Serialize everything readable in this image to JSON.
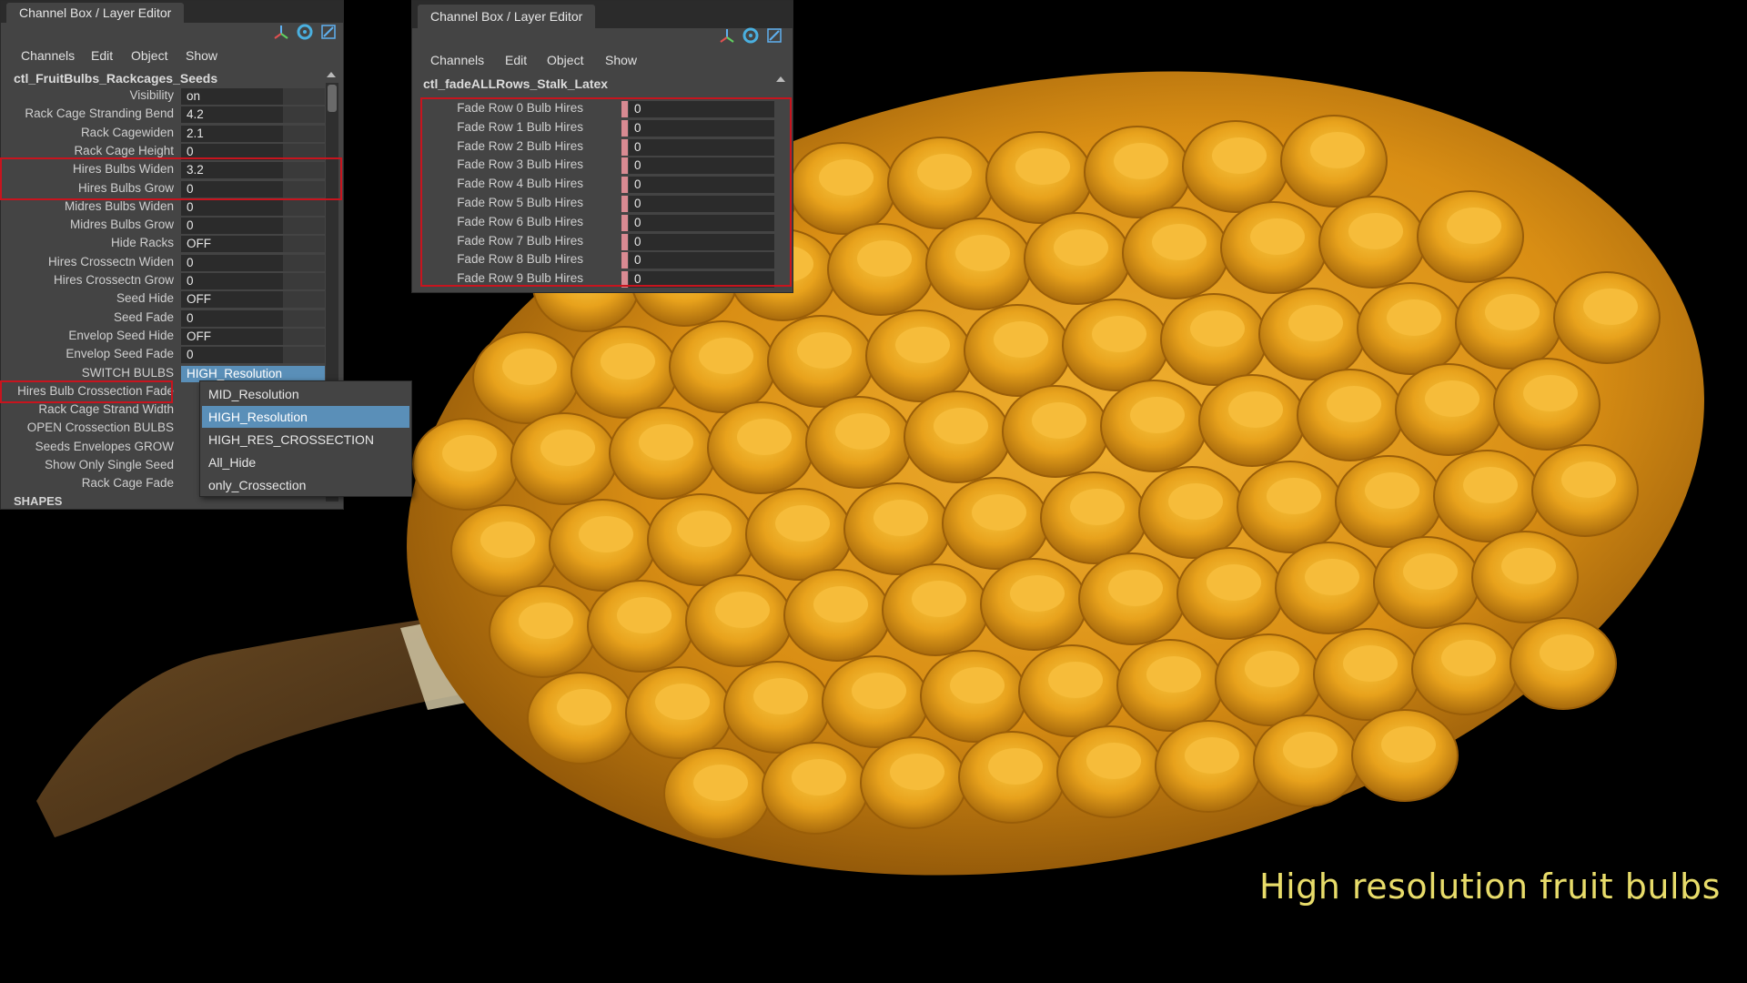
{
  "caption": "High resolution fruit bulbs",
  "colors": {
    "background": "#000000",
    "panel_bg": "#444444",
    "field_bg": "#2b2b2b",
    "selection_blue": "#5a8fb8",
    "highlight_red": "#c8141e",
    "keyed_pink": "#d98a92",
    "caption_yellow": "#e8dc6a",
    "fruit_orange": "#e8a21c"
  },
  "panel_left": {
    "tab_title": "Channel Box / Layer Editor",
    "icons": [
      "axis-icon",
      "sync-icon",
      "expand-icon"
    ],
    "menu": [
      "Channels",
      "Edit",
      "Object",
      "Show"
    ],
    "node_name": "ctl_FruitBulbs_Rackcages_Seeds",
    "channels": [
      {
        "label": "Visibility",
        "value": "on"
      },
      {
        "label": "Rack Cage Stranding Bend",
        "value": "4.2"
      },
      {
        "label": "Rack Cagewiden",
        "value": "2.1"
      },
      {
        "label": "Rack Cage Height",
        "value": "0"
      },
      {
        "label": "Hires Bulbs Widen",
        "value": "3.2"
      },
      {
        "label": "Hires Bulbs Grow",
        "value": "0"
      },
      {
        "label": "Midres Bulbs Widen",
        "value": "0"
      },
      {
        "label": "Midres Bulbs Grow",
        "value": "0"
      },
      {
        "label": "Hide Racks",
        "value": "OFF"
      },
      {
        "label": "Hires Crossectn Widen",
        "value": "0"
      },
      {
        "label": "Hires Crossectn Grow",
        "value": "0"
      },
      {
        "label": "Seed Hide",
        "value": "OFF"
      },
      {
        "label": "Seed Fade",
        "value": "0"
      },
      {
        "label": "Envelop Seed Hide",
        "value": "OFF"
      },
      {
        "label": "Envelop Seed Fade",
        "value": "0"
      },
      {
        "label": "SWITCH BULBS",
        "value": "HIGH_Resolution"
      },
      {
        "label": "Hires Bulb Crossection Fade",
        "value": ""
      },
      {
        "label": "Rack Cage Strand Width",
        "value": ""
      },
      {
        "label": "OPEN Crossection BULBS",
        "value": ""
      },
      {
        "label": "Seeds Envelopes GROW",
        "value": ""
      },
      {
        "label": "Show Only Single Seed",
        "value": ""
      },
      {
        "label": "Rack Cage Fade",
        "value": ""
      }
    ],
    "section_label": "SHAPES",
    "dropdown_options": [
      "MID_Resolution",
      "HIGH_Resolution",
      "HIGH_RES_CROSSECTION",
      "All_Hide",
      "only_Crossection"
    ],
    "dropdown_selected": "HIGH_Resolution"
  },
  "panel_right": {
    "tab_title": "Channel Box / Layer Editor",
    "icons": [
      "axis-icon",
      "sync-icon",
      "expand-icon"
    ],
    "menu": [
      "Channels",
      "Edit",
      "Object",
      "Show"
    ],
    "node_name": "ctl_fadeALLRows_Stalk_Latex",
    "channels": [
      {
        "label": "Fade Row 0 Bulb Hires",
        "value": "0"
      },
      {
        "label": "Fade Row 1 Bulb Hires",
        "value": "0"
      },
      {
        "label": "Fade Row 2 Bulb Hires",
        "value": "0"
      },
      {
        "label": "Fade Row 3 Bulb Hires",
        "value": "0"
      },
      {
        "label": "Fade Row 4 Bulb Hires",
        "value": "0"
      },
      {
        "label": "Fade Row 5 Bulb Hires",
        "value": "0"
      },
      {
        "label": "Fade Row 6 Bulb Hires",
        "value": "0"
      },
      {
        "label": "Fade Row 7 Bulb Hires",
        "value": "0"
      },
      {
        "label": "Fade Row 8 Bulb Hires",
        "value": "0"
      },
      {
        "label": "Fade Row 9 Bulb Hires",
        "value": "0"
      }
    ]
  }
}
